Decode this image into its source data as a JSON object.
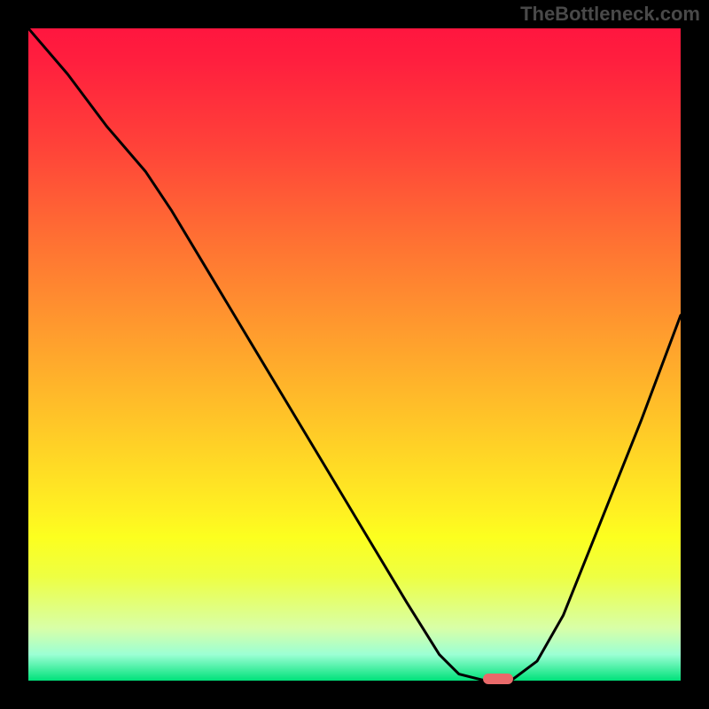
{
  "watermark": "TheBottleneck.com",
  "chart_data": {
    "type": "line",
    "title": "",
    "xlabel": "",
    "ylabel": "",
    "xlim": [
      0,
      100
    ],
    "ylim": [
      0,
      100
    ],
    "x": [
      0,
      6,
      12,
      18,
      22,
      28,
      34,
      40,
      46,
      52,
      58,
      63,
      66,
      70,
      74,
      78,
      82,
      86,
      90,
      94,
      100
    ],
    "values": [
      100,
      93,
      85,
      78,
      72,
      62,
      52,
      42,
      32,
      22,
      12,
      4,
      1,
      0,
      0,
      3,
      10,
      20,
      30,
      40,
      56
    ],
    "marker_x": 72,
    "marker_y": 0,
    "grid": false
  }
}
